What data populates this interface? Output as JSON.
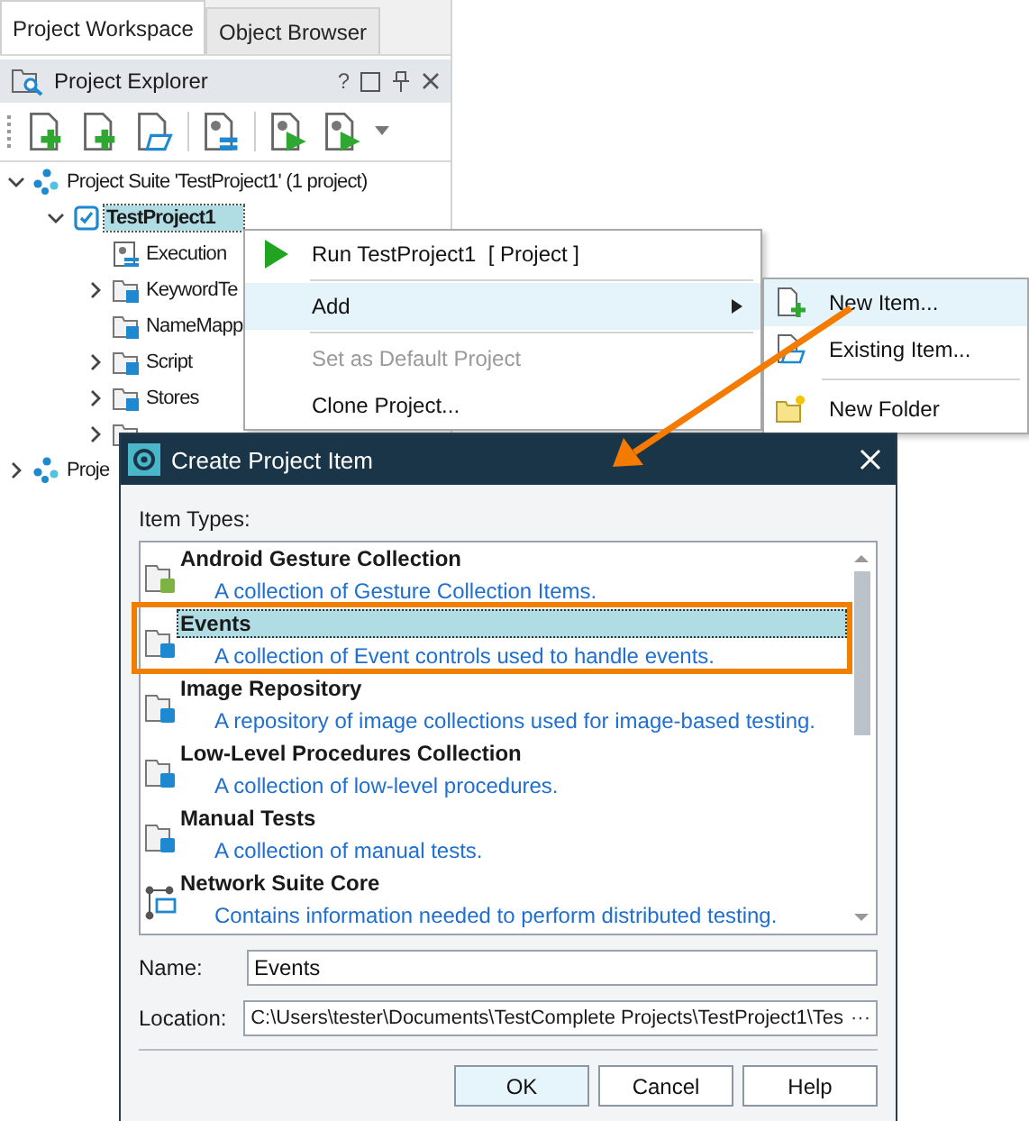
{
  "workspace_tabs": [
    {
      "label": "Project Workspace",
      "selected": true
    },
    {
      "label": "Object Browser",
      "selected": false
    }
  ],
  "explorer": {
    "title": "Project Explorer",
    "help": "?"
  },
  "tree": [
    {
      "label": "Project Suite 'TestProject1' (1 project)",
      "kind": "suite",
      "expanded": true,
      "selected": false,
      "children": [
        {
          "label": "TestProject1",
          "kind": "project",
          "expanded": true,
          "selected": true,
          "children": [
            {
              "label": "Execution",
              "kind": "execution"
            },
            {
              "label": "KeywordTe",
              "kind": "keyword",
              "expanded": false
            },
            {
              "label": "NameMapp",
              "kind": "mapping"
            },
            {
              "label": "Script",
              "kind": "script",
              "expanded": false
            },
            {
              "label": "Stores",
              "kind": "stores",
              "expanded": false
            },
            {
              "kind": "folder",
              "expanded": false
            }
          ]
        }
      ]
    },
    {
      "label": "Proje",
      "kind": "suite",
      "expanded": false,
      "selected": false
    }
  ],
  "context_menu": [
    {
      "kind": "run",
      "label": "Run TestProject1  [ Project ]",
      "highlighted": false,
      "disabled": false,
      "submenu": false
    },
    {
      "kind": "separator"
    },
    {
      "kind": "plain",
      "label": "Add",
      "highlighted": true,
      "disabled": false,
      "submenu": true
    },
    {
      "kind": "separator"
    },
    {
      "kind": "plain",
      "label": "Set as Default Project",
      "highlighted": false,
      "disabled": true,
      "submenu": false
    },
    {
      "kind": "plain",
      "label": "Clone Project...",
      "highlighted": false,
      "disabled": false,
      "submenu": false
    }
  ],
  "submenu": [
    {
      "kind": "new-item",
      "label": "New Item...",
      "highlighted": true
    },
    {
      "kind": "existing-item",
      "label": "Existing Item...",
      "highlighted": false
    },
    {
      "kind": "separator"
    },
    {
      "kind": "new-folder",
      "label": "New Folder",
      "highlighted": false
    }
  ],
  "dialog": {
    "title": "Create Project Item",
    "list_label": "Item Types:",
    "item_types": [
      {
        "kind": "android",
        "title": "Android Gesture Collection",
        "description": "A collection of Gesture Collection Items.",
        "selected": false,
        "callout": false
      },
      {
        "kind": "events",
        "title": "Events",
        "description": "A collection of Event controls used to handle events.",
        "selected": true,
        "callout": true
      },
      {
        "kind": "image",
        "title": "Image Repository",
        "description": "A repository of image collections used for image-based testing.",
        "selected": false,
        "callout": false
      },
      {
        "kind": "procedures",
        "title": "Low-Level Procedures Collection",
        "description": "A collection of low-level procedures.",
        "selected": false,
        "callout": false
      },
      {
        "kind": "manual",
        "title": "Manual Tests",
        "description": "A collection of manual tests.",
        "selected": false,
        "callout": false
      },
      {
        "kind": "network",
        "title": "Network Suite Core",
        "description": "Contains information needed to perform distributed testing.",
        "selected": false,
        "callout": false
      }
    ],
    "name_label": "Name:",
    "name_value": "Events",
    "location_label": "Location:",
    "location_value": "C:\\Users\\tester\\Documents\\TestComplete Projects\\TestProject1\\Tes",
    "browse": "···",
    "buttons": [
      {
        "label": "OK",
        "default": true
      },
      {
        "label": "Cancel",
        "default": false
      },
      {
        "label": "Help",
        "default": false
      }
    ]
  }
}
